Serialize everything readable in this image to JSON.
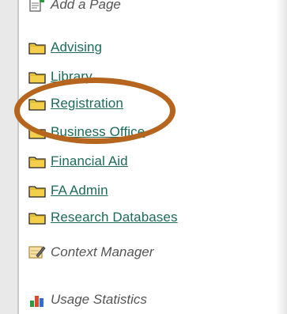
{
  "menu": {
    "add_page_label": "Add a Page",
    "folders": [
      {
        "label": "Advising"
      },
      {
        "label": "Library"
      },
      {
        "label": "Registration"
      },
      {
        "label": "Business Office"
      },
      {
        "label": "Financial Aid"
      },
      {
        "label": "FA Admin"
      },
      {
        "label": "Research Databases"
      }
    ],
    "tools": [
      {
        "label": "Context Manager",
        "icon": "pencil-note-icon"
      },
      {
        "label": "Usage Statistics",
        "icon": "bar-chart-icon"
      }
    ]
  },
  "colors": {
    "link": "#1d6b58",
    "folder": "#f3cf4b",
    "highlight": "#b5651d"
  }
}
